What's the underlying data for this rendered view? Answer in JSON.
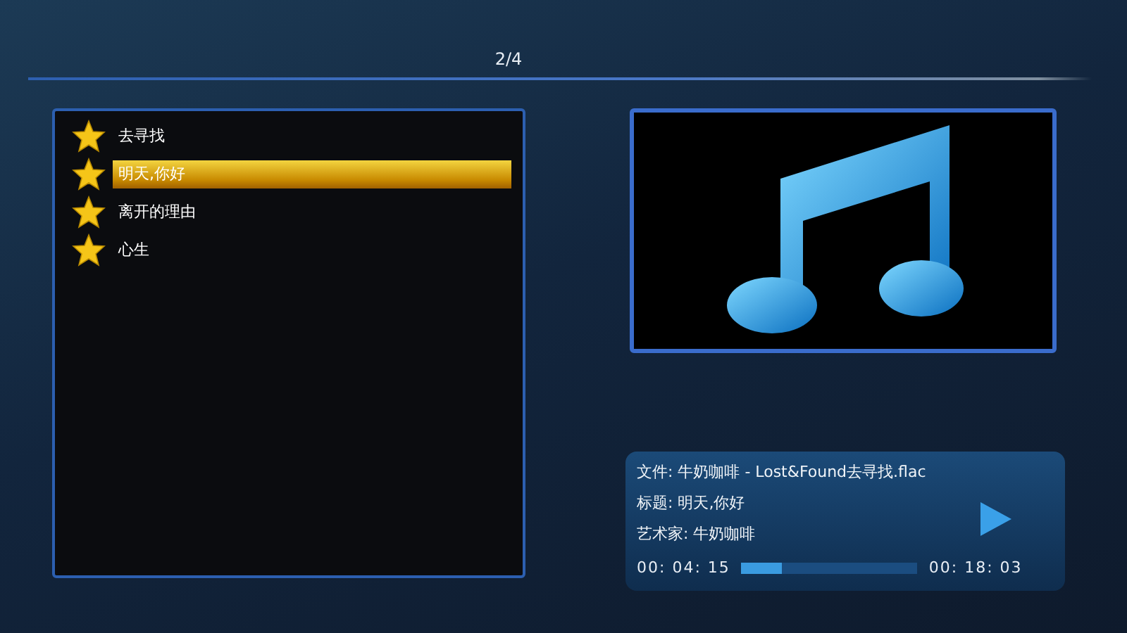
{
  "header": {
    "page_indicator": "2/4"
  },
  "playlist": [
    {
      "title": "去寻找",
      "selected": false
    },
    {
      "title": "明天,你好",
      "selected": true
    },
    {
      "title": "离开的理由",
      "selected": false
    },
    {
      "title": "心生",
      "selected": false
    }
  ],
  "now_playing": {
    "file": "文件: 牛奶咖啡 - Lost&Found去寻找.flac",
    "title": "标题: 明天,你好",
    "artist": "艺术家: 牛奶咖啡",
    "elapsed": "00: 04: 15",
    "total": "00: 18: 03",
    "level": 0.23
  }
}
